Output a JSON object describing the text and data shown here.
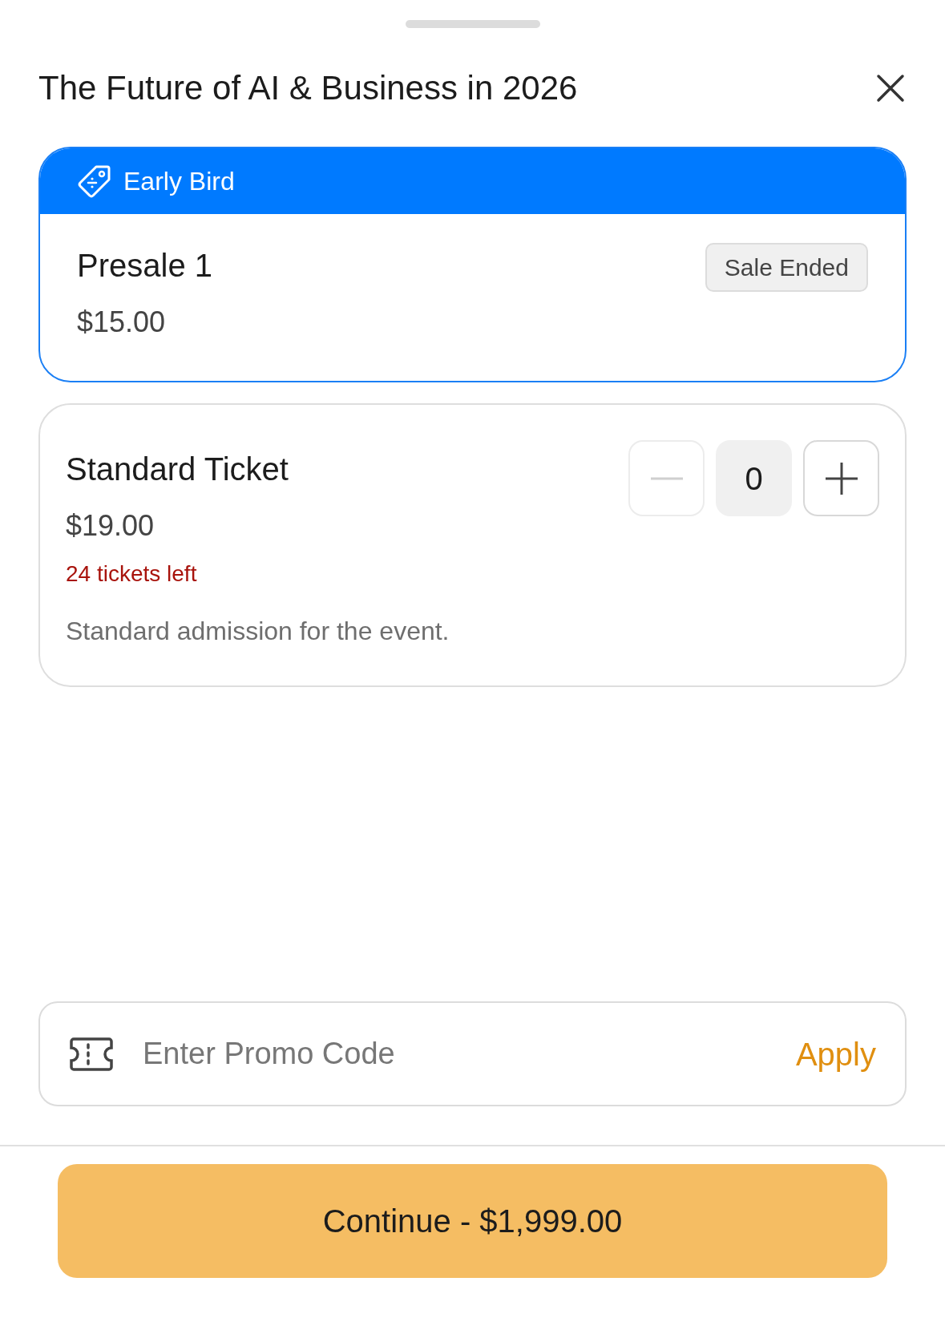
{
  "sheet": {
    "title": "The Future of AI & Business in 2026"
  },
  "tickets": [
    {
      "kind": "group",
      "header": "Early Bird",
      "name": "Presale 1",
      "price": "$15.00",
      "badge": "Sale Ended"
    },
    {
      "kind": "standard",
      "name": "Standard Ticket",
      "price": "$19.00",
      "remaining": "24 tickets left",
      "description": "Standard admission for the event.",
      "quantity": "0",
      "decrement_disabled": true
    }
  ],
  "promo": {
    "placeholder": "Enter Promo Code",
    "action": "Apply"
  },
  "continue_button": "Continue - $1,999.00"
}
